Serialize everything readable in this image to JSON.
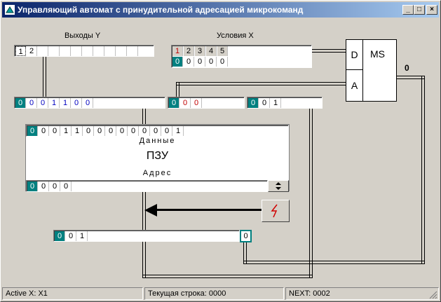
{
  "window": {
    "title": "Управляющий автомат с принудительной адресацией микрокоманд",
    "controls": {
      "minimize": "_",
      "maximize": "□",
      "close": "×"
    }
  },
  "outputs": {
    "label": "Выходы Y",
    "cells": [
      "1",
      "2",
      "",
      "",
      "",
      "",
      "",
      "",
      "",
      "",
      "",
      ""
    ]
  },
  "conditions": {
    "label": "Условия X",
    "headers": [
      "1",
      "2",
      "3",
      "4",
      "5"
    ],
    "values": [
      "0",
      "0",
      "0",
      "0",
      "0"
    ]
  },
  "reg_y": {
    "cells": [
      "0",
      "0",
      "0",
      "1",
      "1",
      "0",
      "0"
    ]
  },
  "reg_x": {
    "cells": [
      "0",
      "0",
      "0"
    ]
  },
  "reg_next": {
    "cells": [
      "0",
      "0",
      "1"
    ]
  },
  "rom": {
    "data_cells": [
      "0",
      "0",
      "0",
      "1",
      "1",
      "0",
      "0",
      "0",
      "0",
      "0",
      "0",
      "0",
      "0",
      "1"
    ],
    "data_label": "Данные",
    "name": "ПЗУ",
    "address_label": "Адрес",
    "address_cells": [
      "0",
      "0",
      "0",
      "0"
    ]
  },
  "counter": {
    "cells": [
      "0",
      "0",
      "1"
    ],
    "out_value": "0"
  },
  "ms": {
    "input_d": "D",
    "input_a": "A",
    "name": "MS",
    "output_value": "0"
  },
  "status": {
    "active": "Active X: X1",
    "current_row": "Текущая строка: 0000",
    "next": "NEXT: 0002"
  },
  "colors": {
    "accent": "#008080",
    "title_start": "#0a246a",
    "title_end": "#a6caf0",
    "red": "#c00000",
    "blue": "#0000c0"
  },
  "icons": {
    "app": "app-icon",
    "step": "lightning-icon",
    "arrow": "arrow-left-icon"
  }
}
